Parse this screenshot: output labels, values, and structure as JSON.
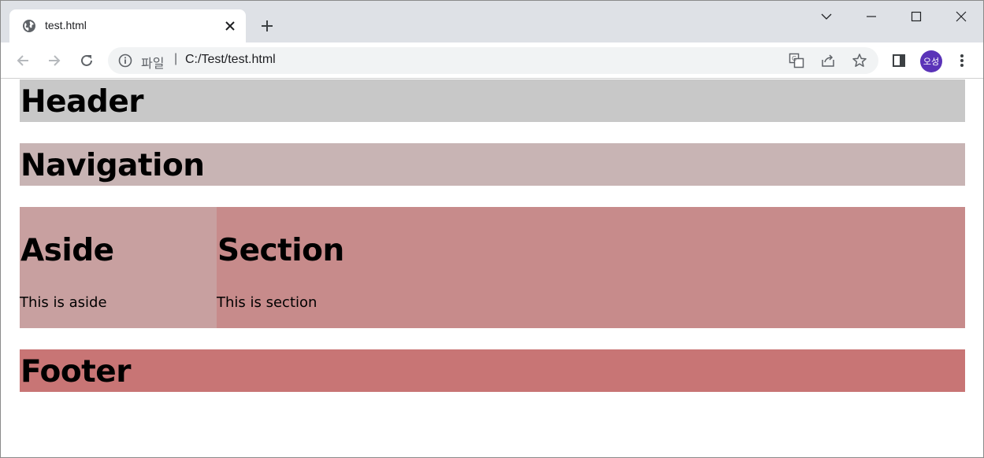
{
  "browser": {
    "tab": {
      "title": "test.html",
      "favicon": "globe-icon"
    },
    "omnibox": {
      "scheme_label": "파일",
      "separator": "|",
      "url": "C:/Test/test.html"
    },
    "profile": {
      "initials": "오성",
      "color": "#5a33b8"
    }
  },
  "page": {
    "header": {
      "title": "Header",
      "color": "#c8c8c8"
    },
    "nav": {
      "title": "Navigation",
      "color": "#c8b4b4"
    },
    "aside": {
      "title": "Aside",
      "text": "This is aside",
      "color": "#c8a0a0"
    },
    "section": {
      "title": "Section",
      "text": "This is section",
      "color": "#c78b8b"
    },
    "footer": {
      "title": "Footer",
      "color": "#c87575"
    }
  }
}
